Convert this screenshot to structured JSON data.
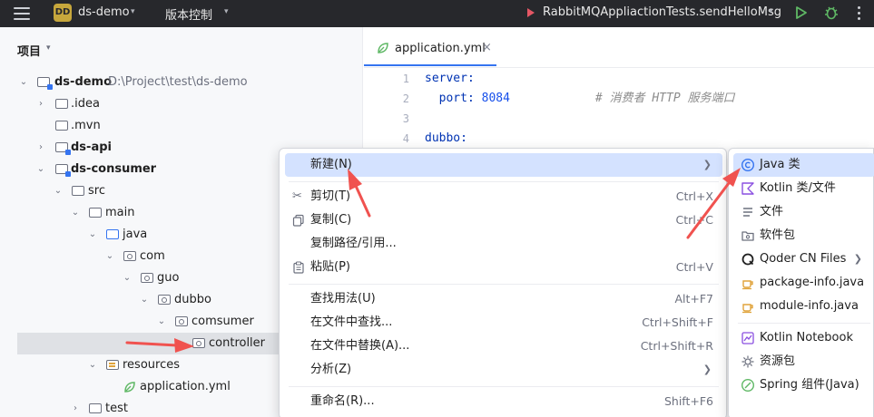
{
  "topbar": {
    "badge": "DD",
    "project_name": "ds-demo",
    "vcs_label": "版本控制",
    "run_config": "RabbitMQAppliactionTests.sendHelloMsg"
  },
  "project_panel": {
    "title": "项目",
    "tree": [
      {
        "label": "ds-demo",
        "path": "D:\\Project\\test\\ds-demo"
      },
      {
        "label": ".idea"
      },
      {
        "label": ".mvn"
      },
      {
        "label": "ds-api"
      },
      {
        "label": "ds-consumer"
      },
      {
        "label": "src"
      },
      {
        "label": "main"
      },
      {
        "label": "java"
      },
      {
        "label": "com"
      },
      {
        "label": "guo"
      },
      {
        "label": "dubbo"
      },
      {
        "label": "comsumer"
      },
      {
        "label": "controller"
      },
      {
        "label": "resources"
      },
      {
        "label": "application.yml"
      },
      {
        "label": "test"
      }
    ]
  },
  "editor": {
    "tab_label": "application.yml",
    "tab_close": "×",
    "lines": [
      {
        "n": "1",
        "key": "server:",
        "val": "",
        "comment": ""
      },
      {
        "n": "2",
        "key": "  port: ",
        "val": "8084",
        "comment": "            # 消费者 HTTP 服务端口"
      },
      {
        "n": "3",
        "key": "",
        "val": "",
        "comment": ""
      },
      {
        "n": "4",
        "key": "dubbo:",
        "val": "",
        "comment": ""
      }
    ]
  },
  "context_menu": {
    "items": [
      {
        "label": "新建(N)",
        "shortcut": "",
        "icon": "none"
      },
      {
        "label": "剪切(T)",
        "shortcut": "Ctrl+X",
        "icon": "scissors-icon"
      },
      {
        "label": "复制(C)",
        "shortcut": "Ctrl+C",
        "icon": "copy-icon"
      },
      {
        "label": "复制路径/引用...",
        "shortcut": "",
        "icon": "none"
      },
      {
        "label": "粘贴(P)",
        "shortcut": "Ctrl+V",
        "icon": "paste-icon"
      },
      {
        "label": "查找用法(U)",
        "shortcut": "Alt+F7",
        "icon": "none"
      },
      {
        "label": "在文件中查找...",
        "shortcut": "Ctrl+Shift+F",
        "icon": "none"
      },
      {
        "label": "在文件中替换(A)...",
        "shortcut": "Ctrl+Shift+R",
        "icon": "none"
      },
      {
        "label": "分析(Z)",
        "shortcut": "",
        "icon": "none"
      },
      {
        "label": "重命名(R)...",
        "shortcut": "Shift+F6",
        "icon": "none"
      }
    ]
  },
  "submenu": {
    "items": [
      {
        "label": "Java 类",
        "icon": "java-class-icon"
      },
      {
        "label": "Kotlin 类/文件",
        "icon": "kotlin-icon"
      },
      {
        "label": "文件",
        "icon": "file-icon"
      },
      {
        "label": "软件包",
        "icon": "package-icon"
      },
      {
        "label": "Qoder CN Files",
        "icon": "qoder-icon"
      },
      {
        "label": "package-info.java",
        "icon": "java-file-icon"
      },
      {
        "label": "module-info.java",
        "icon": "java-file-icon"
      },
      {
        "label": "Kotlin Notebook",
        "icon": "notebook-icon"
      },
      {
        "label": "资源包",
        "icon": "resource-bundle-icon"
      },
      {
        "label": "Spring 组件(Java)",
        "icon": "spring-icon"
      }
    ]
  },
  "colors": {
    "accent": "#3574f0",
    "menu_highlight": "#d4e2ff",
    "annotation_arrow": "#f0524f",
    "topbar_bg": "#27282c"
  }
}
